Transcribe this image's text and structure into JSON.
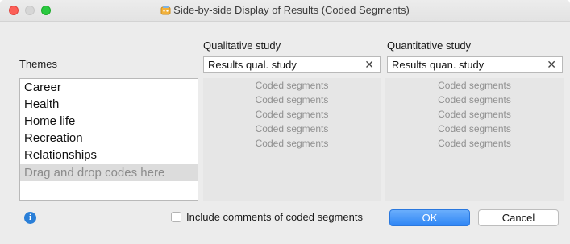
{
  "window": {
    "title": "Side-by-side Display of Results (Coded Segments)"
  },
  "themes": {
    "label": "Themes",
    "items": [
      "Career",
      "Health",
      "Home life",
      "Recreation",
      "Relationships"
    ],
    "drop_placeholder": "Drag and drop codes here"
  },
  "qualitative": {
    "label": "Qualitative study",
    "selected": "Results qual. study",
    "clear_glyph": "✕",
    "segments": [
      "Coded segments",
      "Coded segments",
      "Coded segments",
      "Coded segments",
      "Coded segments"
    ]
  },
  "quantitative": {
    "label": "Quantitative study",
    "selected": "Results quan. study",
    "clear_glyph": "✕",
    "segments": [
      "Coded segments",
      "Coded segments",
      "Coded segments",
      "Coded segments",
      "Coded segments"
    ]
  },
  "footer": {
    "info_glyph": "i",
    "include_comments_label": "Include comments of coded segments",
    "include_comments_checked": false,
    "ok_label": "OK",
    "cancel_label": "Cancel"
  },
  "colors": {
    "accent": "#2f86f5",
    "info": "#2a7fd8",
    "close": "#fc5f57",
    "zoom": "#2ac940"
  },
  "icons": [
    "close-window-icon",
    "minimize-window-icon",
    "zoom-window-icon",
    "app-icon",
    "clear-icon",
    "info-icon"
  ]
}
